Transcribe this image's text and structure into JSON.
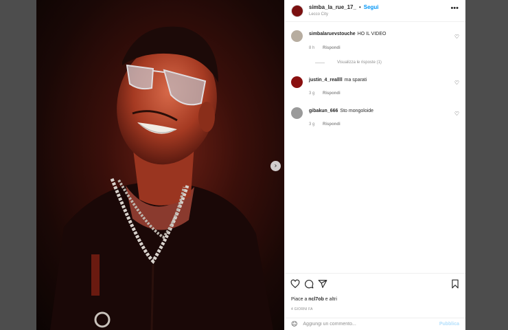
{
  "post": {
    "username": "simba_la_rue_17_",
    "separator": "•",
    "follow_label": "Segui",
    "location": "Lecco City",
    "more_icon": "more-horizontal-icon"
  },
  "comments": [
    {
      "username": "simbalaruevstouche",
      "text": "HO IL VIDEO",
      "time": "8 h",
      "reply_label": "Rispondi",
      "view_replies": "Visualizza le risposte (1)"
    },
    {
      "username": "justin_4_reallll",
      "text": "ma sparati",
      "time": "3 g",
      "reply_label": "Rispondi"
    },
    {
      "username": "gibakun_666",
      "text": "Sto mongoloide",
      "time": "3 g",
      "reply_label": "Rispondi"
    }
  ],
  "actions": {
    "likes_prefix": "Piace a ",
    "likes_user": "ncl7ob",
    "likes_suffix": " e altri",
    "timestamp": "4 GIORNI FA"
  },
  "composer": {
    "placeholder": "Aggiungi un commento...",
    "publish_label": "Pubblica"
  },
  "colors": {
    "accent": "#0095f6",
    "publish_disabled": "#b2dffc"
  }
}
